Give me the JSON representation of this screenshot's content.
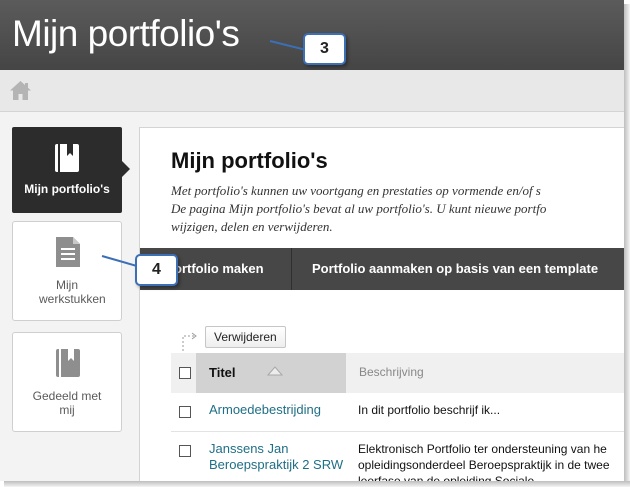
{
  "header": {
    "title": "Mijn portfolio's"
  },
  "breadcrumb": {
    "home_icon": "home-icon"
  },
  "sidebar": {
    "items": [
      {
        "label": "Mijn portfolio's",
        "icon": "portfolio-book-icon",
        "active": true
      },
      {
        "label": "Mijn werkstukken",
        "icon": "document-icon",
        "active": false
      },
      {
        "label": "Gedeeld met mij",
        "icon": "shared-book-icon",
        "active": false
      }
    ]
  },
  "main": {
    "title": "Mijn portfolio's",
    "description": [
      "Met portfolio's kunnen uw voortgang en prestaties op vormende en/of s",
      "De pagina Mijn portfolio's bevat al uw portfolio's. U kunt nieuwe portfo",
      "wijzigen, delen en verwijderen."
    ],
    "actions": [
      {
        "label": "ortfolio maken"
      },
      {
        "label": "Portfolio aanmaken op basis van een template"
      }
    ],
    "delete_label": "Verwijderen",
    "table": {
      "columns": [
        "Titel",
        "Beschrijving"
      ],
      "rows": [
        {
          "title": [
            "Armoedebestrijding"
          ],
          "description": [
            "In dit portfolio beschrijf ik..."
          ]
        },
        {
          "title": [
            "Janssens Jan",
            "Beroepspraktijk 2 SRW"
          ],
          "description": [
            "Elektronisch Portfolio ter ondersteuning van he",
            "opleidingsonderdeel Beroepspraktijk in de twee",
            "leerfase van de opleiding Sociale"
          ]
        }
      ]
    }
  },
  "callouts": [
    {
      "label": "3"
    },
    {
      "label": "4"
    }
  ],
  "colors": {
    "topbar": "#4f4f4f",
    "active_tile": "#2c2c2c",
    "actionbar": "#474747",
    "link": "#1f6f86",
    "callout_border": "#3b6fb6"
  }
}
